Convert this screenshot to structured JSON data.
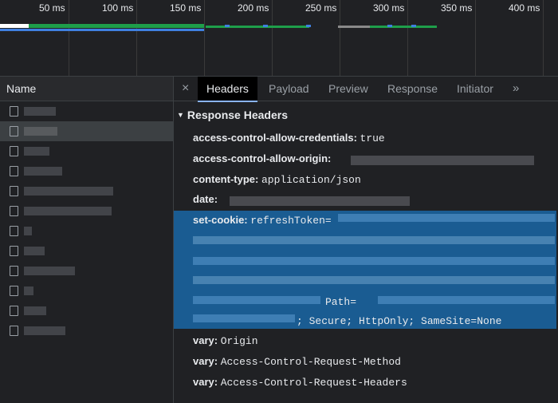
{
  "timeline": {
    "ticks": [
      "50 ms",
      "100 ms",
      "150 ms",
      "200 ms",
      "250 ms",
      "300 ms",
      "350 ms",
      "400 ms"
    ]
  },
  "requests": {
    "column_header": "Name",
    "rows": 12
  },
  "tabs": {
    "close_symbol": "×",
    "items": [
      "Headers",
      "Payload",
      "Preview",
      "Response",
      "Initiator"
    ],
    "active": "Headers",
    "more_symbol": "»"
  },
  "response_headers": {
    "title": "Response Headers",
    "rows": [
      {
        "name": "access-control-allow-credentials:",
        "value": "true"
      },
      {
        "name": "access-control-allow-origin:",
        "value": ""
      },
      {
        "name": "content-type:",
        "value": "application/json"
      },
      {
        "name": "date:",
        "value": ""
      },
      {
        "name": "set-cookie:",
        "value": "refreshToken="
      },
      {
        "name": "vary:",
        "value": "Origin"
      },
      {
        "name": "vary:",
        "value": "Access-Control-Request-Method"
      },
      {
        "name": "vary:",
        "value": "Access-Control-Request-Headers"
      }
    ],
    "cookie_path_label": "Path=",
    "cookie_flags": "; Secure; HttpOnly; SameSite=None"
  },
  "colors": {
    "background": "#202124",
    "selection": "#1a5c92",
    "timeline_green": "#1e9e4a",
    "timeline_blue": "#3f80e0"
  }
}
